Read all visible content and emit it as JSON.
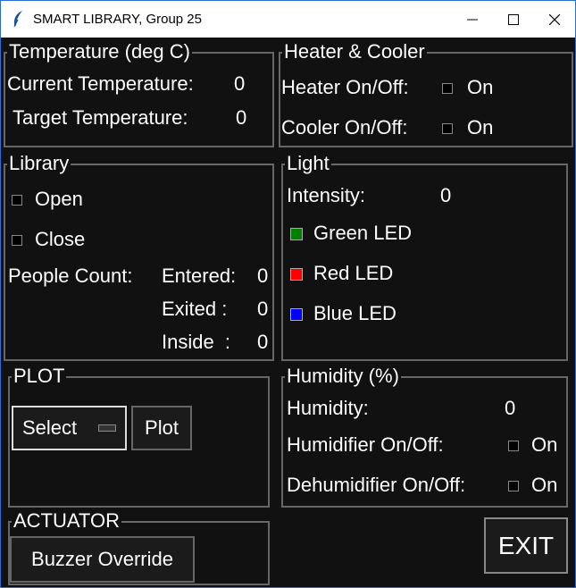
{
  "window": {
    "title": "SMART LIBRARY, Group 25"
  },
  "temperature": {
    "title": "Temperature (deg C)",
    "current_label": "Current Temperature:",
    "current_value": "0",
    "target_label": "Target Temperature:",
    "target_value": "0"
  },
  "heater_cooler": {
    "title": "Heater & Cooler",
    "heater_label": "Heater On/Off:",
    "heater_state": "On",
    "cooler_label": "Cooler On/Off:",
    "cooler_state": "On"
  },
  "library": {
    "title": "Library",
    "open_label": "Open",
    "close_label": "Close",
    "people_count_label": "People Count:",
    "entered_label": "Entered:",
    "entered_value": "0",
    "exited_label": "Exited :",
    "exited_value": "0",
    "inside_label": "Inside  :",
    "inside_value": "0"
  },
  "light": {
    "title": "Light",
    "intensity_label": "Intensity:",
    "intensity_value": "0",
    "green_label": "Green LED",
    "red_label": "Red LED",
    "blue_label": "Blue LED",
    "colors": {
      "green": "#008000",
      "red": "#ff0000",
      "blue": "#0000ff"
    }
  },
  "plot": {
    "title": "PLOT",
    "select_label": "Select",
    "plot_button": "Plot"
  },
  "humidity": {
    "title": "Humidity (%)",
    "humidity_label": "Humidity:",
    "humidity_value": "0",
    "humidifier_label": "Humidifier On/Off:",
    "humidifier_state": "On",
    "dehumidifier_label": "Dehumidifier On/Off:",
    "dehumidifier_state": "On"
  },
  "actuator": {
    "title": "ACTUATOR",
    "buzzer_button": "Buzzer Override"
  },
  "exit_button": "EXIT"
}
